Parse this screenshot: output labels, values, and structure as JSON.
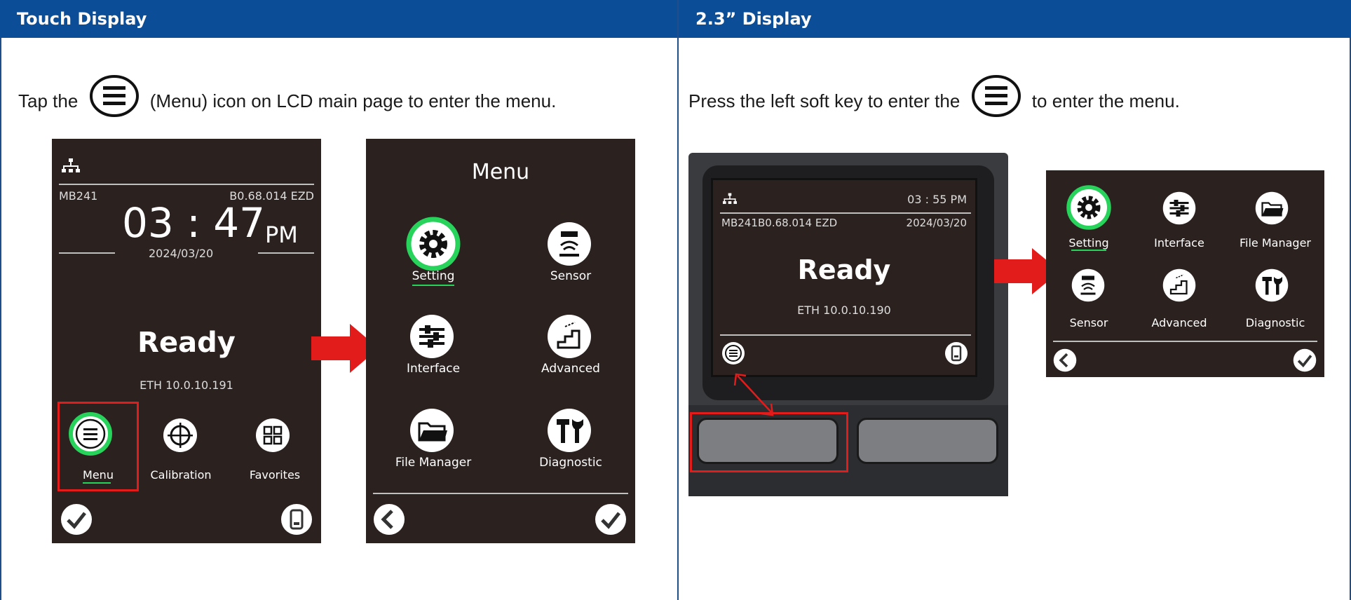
{
  "headers": {
    "left": "Touch Display",
    "right": "2.3” Display"
  },
  "left_instruction": {
    "before": "Tap the",
    "after": "(Menu) icon on LCD main page to enter the menu."
  },
  "right_instruction": {
    "before": "Press the left soft key to enter the",
    "after": "to enter the menu."
  },
  "touch_main": {
    "model": "MB241",
    "firmware": "B0.68.014 EZD",
    "time": "03 : 47",
    "ampm": "PM",
    "date": "2024/03/20",
    "status": "Ready",
    "ip": "ETH 10.0.10.191",
    "items": [
      "Menu",
      "Calibration",
      "Favorites"
    ]
  },
  "touch_menu": {
    "title": "Menu",
    "items": [
      "Setting",
      "Sensor",
      "Interface",
      "Advanced",
      "File Manager",
      "Diagnostic"
    ]
  },
  "small_main": {
    "time": "03 : 55 PM",
    "model": "MB241",
    "firmware": "B0.68.014 EZD",
    "date": "2024/03/20",
    "status": "Ready",
    "ip": "ETH 10.0.10.190"
  },
  "small_menu": {
    "items": [
      "Setting",
      "Interface",
      "File Manager",
      "Sensor",
      "Advanced",
      "Diagnostic"
    ]
  },
  "colors": {
    "header_bg": "#0b4d96",
    "screen_bg": "#2b2220",
    "highlight_ring": "#27d35a",
    "callout_red": "#e21b1b"
  }
}
